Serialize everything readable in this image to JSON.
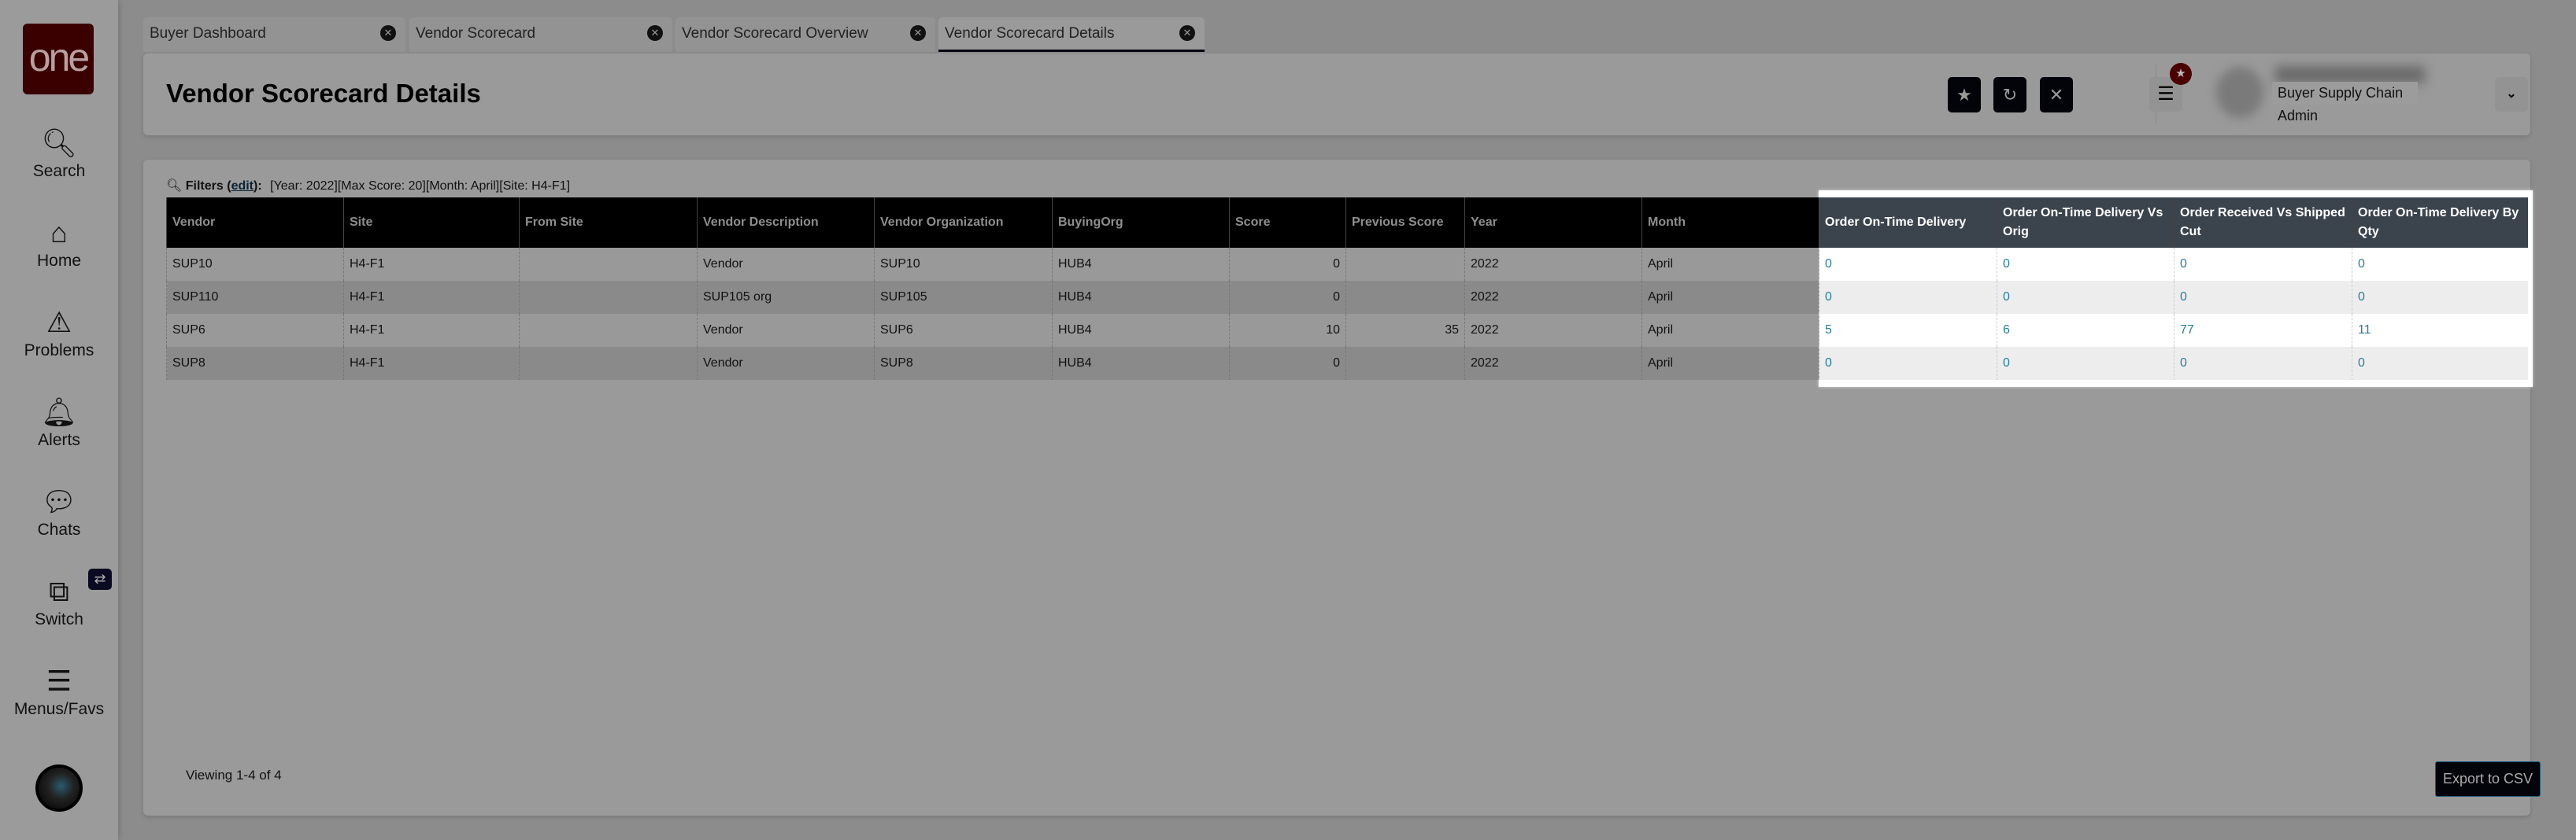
{
  "sidebar": {
    "logo": "one",
    "items": [
      {
        "label": "Search"
      },
      {
        "label": "Home"
      },
      {
        "label": "Problems"
      },
      {
        "label": "Alerts"
      },
      {
        "label": "Chats"
      },
      {
        "label": "Switch"
      },
      {
        "label": "Menus/Favs"
      }
    ]
  },
  "tabs": [
    {
      "label": "Buyer Dashboard"
    },
    {
      "label": "Vendor Scorecard"
    },
    {
      "label": "Vendor Scorecard Overview"
    },
    {
      "label": "Vendor Scorecard Details"
    }
  ],
  "header": {
    "title": "Vendor Scorecard Details",
    "role": "Buyer Supply Chain Admin"
  },
  "filters": {
    "label": "Filters (",
    "edit": "edit",
    "suffix": "):",
    "value": "[Year: 2022][Max Score: 20][Month: April][Site: H4-F1]"
  },
  "table": {
    "columns": [
      "Vendor",
      "Site",
      "From Site",
      "Vendor Description",
      "Vendor Organization",
      "BuyingOrg",
      "Score",
      "Previous Score",
      "Year",
      "Month",
      "Order On-Time Delivery",
      "Order On-Time Delivery Vs Orig",
      "Order Received Vs Shipped Cut",
      "Order On-Time Delivery By Qty"
    ],
    "rows": [
      [
        "SUP10",
        "H4-F1",
        "",
        "Vendor",
        "SUP10",
        "HUB4",
        "0",
        "",
        "2022",
        "April",
        "0",
        "0",
        "0",
        "0"
      ],
      [
        "SUP110",
        "H4-F1",
        "",
        "SUP105 org",
        "SUP105",
        "HUB4",
        "0",
        "",
        "2022",
        "April",
        "0",
        "0",
        "0",
        "0"
      ],
      [
        "SUP6",
        "H4-F1",
        "",
        "Vendor",
        "SUP6",
        "HUB4",
        "10",
        "35",
        "2022",
        "April",
        "5",
        "6",
        "77",
        "11"
      ],
      [
        "SUP8",
        "H4-F1",
        "",
        "Vendor",
        "SUP8",
        "HUB4",
        "0",
        "",
        "2022",
        "April",
        "0",
        "0",
        "0",
        "0"
      ]
    ]
  },
  "footer": {
    "viewing": "Viewing 1-4 of 4",
    "export_label": "Export to CSV"
  },
  "colors": {
    "highlight_header": "#3b434d",
    "link_value": "#2a7d9a",
    "logo": "#3a0000"
  }
}
